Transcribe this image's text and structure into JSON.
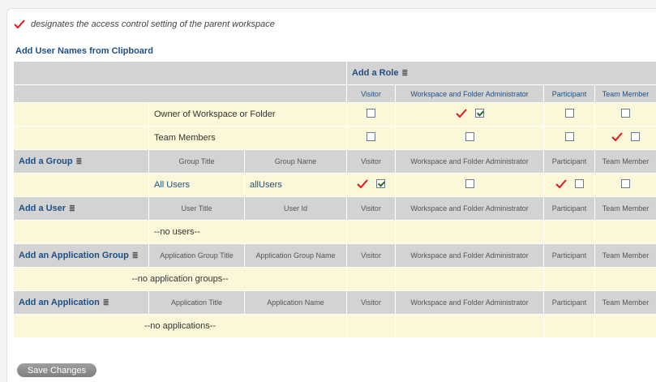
{
  "legend": {
    "text": "designates the access control setting of the parent workspace"
  },
  "clipboard_link": "Add User Names from Clipboard",
  "add_role": "Add a Role",
  "roles": [
    "Visitor",
    "Workspace and Folder Administrator",
    "Participant",
    "Team Member"
  ],
  "special_rows": [
    {
      "label": "Owner of Workspace or Folder",
      "checks": [
        false,
        true,
        false,
        false
      ],
      "parent": [
        false,
        true,
        false,
        false
      ]
    },
    {
      "label": "Team Members",
      "checks": [
        false,
        false,
        false,
        false
      ],
      "parent": [
        false,
        false,
        false,
        true
      ]
    }
  ],
  "groups": {
    "add_label": "Add a Group",
    "col1": "Group Title",
    "col2": "Group Name",
    "rows": [
      {
        "title": "All Users",
        "name": "allUsers",
        "checks": [
          true,
          false,
          false,
          false
        ],
        "parent": [
          true,
          false,
          true,
          false
        ]
      }
    ]
  },
  "users": {
    "add_label": "Add a User",
    "col1": "User Title",
    "col2": "User Id",
    "empty": "--no users--"
  },
  "app_groups": {
    "add_label": "Add an Application Group",
    "col1": "Application Group Title",
    "col2": "Application Group Name",
    "empty": "--no application groups--"
  },
  "apps": {
    "add_label": "Add an Application",
    "col1": "Application Title",
    "col2": "Application Name",
    "empty": "--no applications--"
  },
  "save_label": "Save Changes",
  "colors": {
    "link": "#1c4f86",
    "header_bg": "#d3d3d3",
    "row_bg": "#fbf8d9",
    "check_red": "#e0171b"
  },
  "icons": {
    "parent_mark": "red-check-icon",
    "filter": "filter-icon"
  }
}
